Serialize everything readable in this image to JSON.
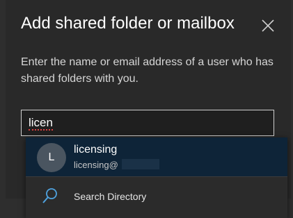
{
  "dialog": {
    "title": "Add shared folder or mailbox",
    "description": "Enter the name or email address of a user who has shared folders with you.",
    "close_icon": "close-icon"
  },
  "input": {
    "value": "licen"
  },
  "suggestions": {
    "items": [
      {
        "initial": "L",
        "name": "licensing",
        "email": "licensing@"
      }
    ],
    "search_directory_label": "Search Directory",
    "search_icon": "search-icon"
  },
  "colors": {
    "accent": "#4fa3e0",
    "selected_bg": "#0e2438",
    "background": "#292929"
  }
}
